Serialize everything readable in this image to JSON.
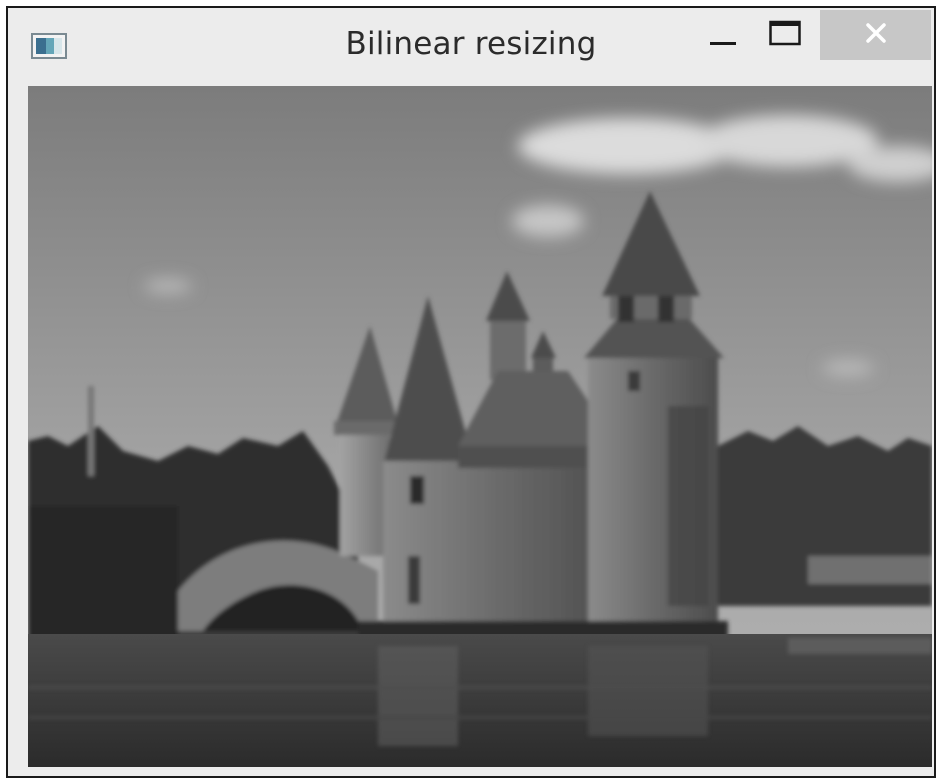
{
  "window": {
    "title": "Bilinear resizing"
  },
  "title_bar_controls": {
    "minimize_icon": "minimize-icon",
    "maximize_icon": "maximize-icon",
    "close_icon": "close-icon"
  },
  "app_icon": "window-app-icon",
  "image_content": {
    "subject": "grayscale photo of a stone castle boathouse on water",
    "rendering": "bilinear-resized, slightly blurred"
  },
  "colors": {
    "title_bar": "#ececec",
    "close_button": "#c7c7c7",
    "window_border": "#1a1a1a",
    "title_text": "#2b2b2b"
  }
}
